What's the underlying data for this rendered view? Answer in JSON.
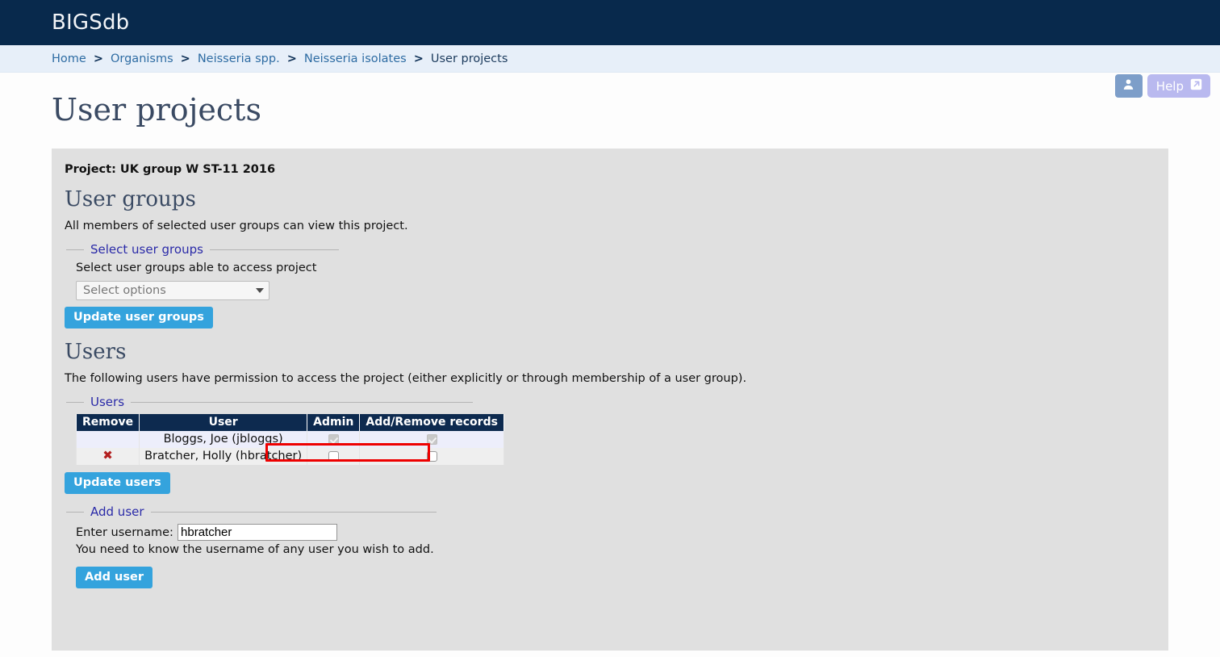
{
  "header": {
    "logo": "BIGSdb"
  },
  "breadcrumb": {
    "separator": ">",
    "items": [
      {
        "label": "Home",
        "current": false
      },
      {
        "label": "Organisms",
        "current": false
      },
      {
        "label": "Neisseria spp.",
        "current": false
      },
      {
        "label": "Neisseria isolates",
        "current": false
      },
      {
        "label": "User projects",
        "current": true
      }
    ]
  },
  "top_controls": {
    "user_icon": "user-icon",
    "help_label": "Help",
    "help_icon": "external-link-icon"
  },
  "page": {
    "title": "User projects",
    "project_label": "Project: UK group W ST-11 2016"
  },
  "user_groups_section": {
    "heading": "User groups",
    "description": "All members of selected user groups can view this project.",
    "fieldset_legend": "Select user groups",
    "field_label": "Select user groups able to access project",
    "select_placeholder": "Select options",
    "update_button": "Update user groups"
  },
  "users_section": {
    "heading": "Users",
    "description": "The following users have permission to access the project (either explicitly or through membership of a user group).",
    "fieldset_legend": "Users",
    "table": {
      "columns": [
        "Remove",
        "User",
        "Admin",
        "Add/Remove records"
      ],
      "rows": [
        {
          "remove": "",
          "user": "Bloggs, Joe (jbloggs)",
          "admin_checked": true,
          "admin_disabled": true,
          "addremove_checked": true,
          "addremove_disabled": true
        },
        {
          "remove": "✖",
          "user": "Bratcher, Holly (hbratcher)",
          "admin_checked": false,
          "admin_disabled": false,
          "addremove_checked": false,
          "addremove_disabled": false
        }
      ]
    },
    "update_button": "Update users"
  },
  "add_user_section": {
    "fieldset_legend": "Add user",
    "username_label": "Enter username:",
    "username_value": "hbratcher",
    "username_placeholder": "",
    "hint": "You need to know the username of any user you wish to add.",
    "add_button": "Add user"
  },
  "colors": {
    "header_navy": "#08294c",
    "breadcrumb_bg": "#e7eff9",
    "link_blue": "#2e6ca3",
    "panel_gray": "#e0e0e0",
    "button_blue": "#34a3dd",
    "table_header_navy": "#0d2a4f",
    "highlight_red": "#ee0000",
    "remove_x_red": "#b32020",
    "legend_blue": "#2a2aa8",
    "heading_slate": "#3a4a63"
  }
}
